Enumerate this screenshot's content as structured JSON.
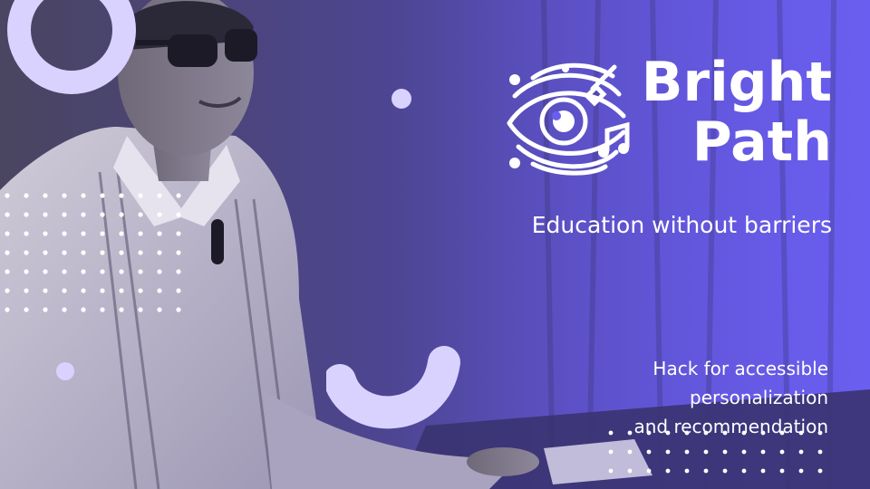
{
  "brand": {
    "title_line1": "Bright",
    "title_line2": "Path",
    "subtitle": "Education without barriers",
    "logo_icon": "eye-with-pencil-and-music-note-icon"
  },
  "tagline": {
    "line1": "Hack for accessible",
    "line2": "personalization",
    "line3": "and recommendation"
  },
  "colors": {
    "accent": "#d9d2ff",
    "purple": "#6a5ef0",
    "text": "#ffffff"
  }
}
